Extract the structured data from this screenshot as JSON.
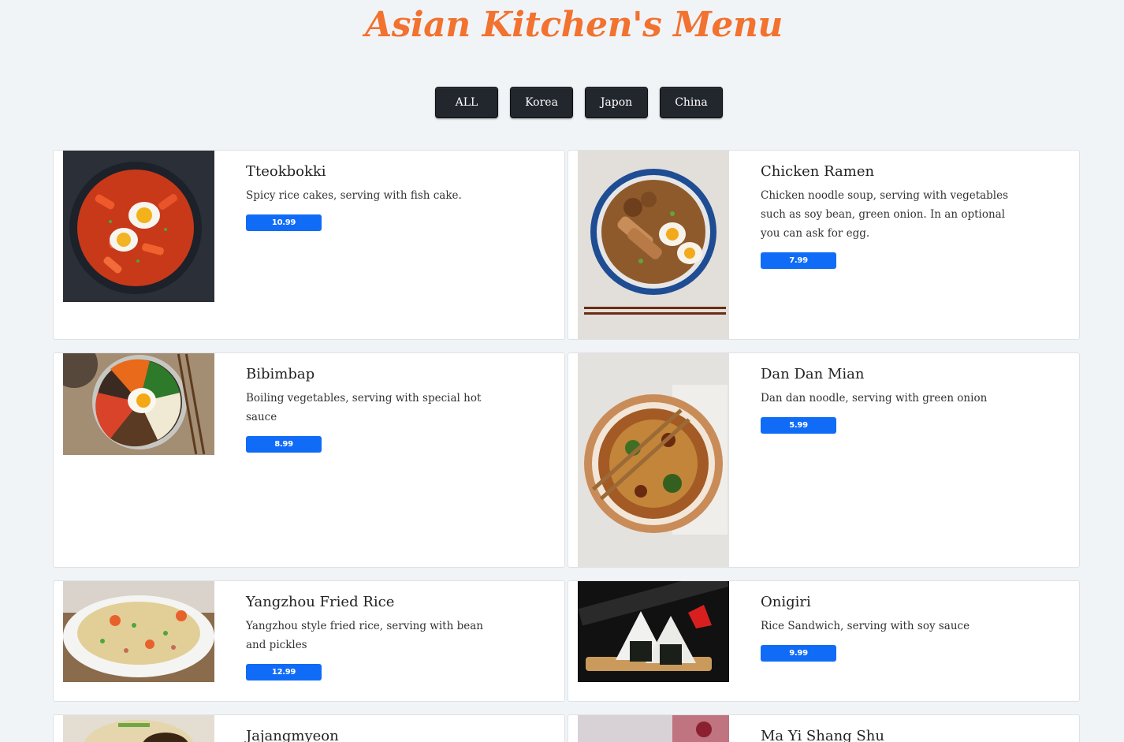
{
  "page": {
    "title": "Asian Kitchen's Menu"
  },
  "filters": [
    "ALL",
    "Korea",
    "Japon",
    "China"
  ],
  "menu": [
    {
      "name": "Tteokbokki",
      "desc": "Spicy rice cakes, serving with fish cake.",
      "price": "10.99",
      "image": "tteokbokki-photo"
    },
    {
      "name": "Chicken Ramen",
      "desc": "Chicken noodle soup, serving with vegetables such as soy bean, green onion. In an optional you can ask for egg.",
      "price": "7.99",
      "image": "chicken-ramen-photo"
    },
    {
      "name": "Bibimbap",
      "desc": "Boiling vegetables, serving with special hot sauce",
      "price": "8.99",
      "image": "bibimbap-photo"
    },
    {
      "name": "Dan Dan Mian",
      "desc": "Dan dan noodle, serving with green onion",
      "price": "5.99",
      "image": "dan-dan-mian-photo"
    },
    {
      "name": "Yangzhou Fried Rice",
      "desc": "Yangzhou style fried rice, serving with bean and pickles",
      "price": "12.99",
      "image": "yangzhou-fried-rice-photo"
    },
    {
      "name": "Onigiri",
      "desc": "Rice Sandwich, serving with soy sauce",
      "price": "9.99",
      "image": "onigiri-photo"
    },
    {
      "name": "Jajangmyeon",
      "desc": "",
      "price": "",
      "image": "jajangmyeon-photo"
    },
    {
      "name": "Ma Yi Shang Shu",
      "desc": "",
      "price": "",
      "image": "ma-yi-shang-shu-photo"
    }
  ]
}
